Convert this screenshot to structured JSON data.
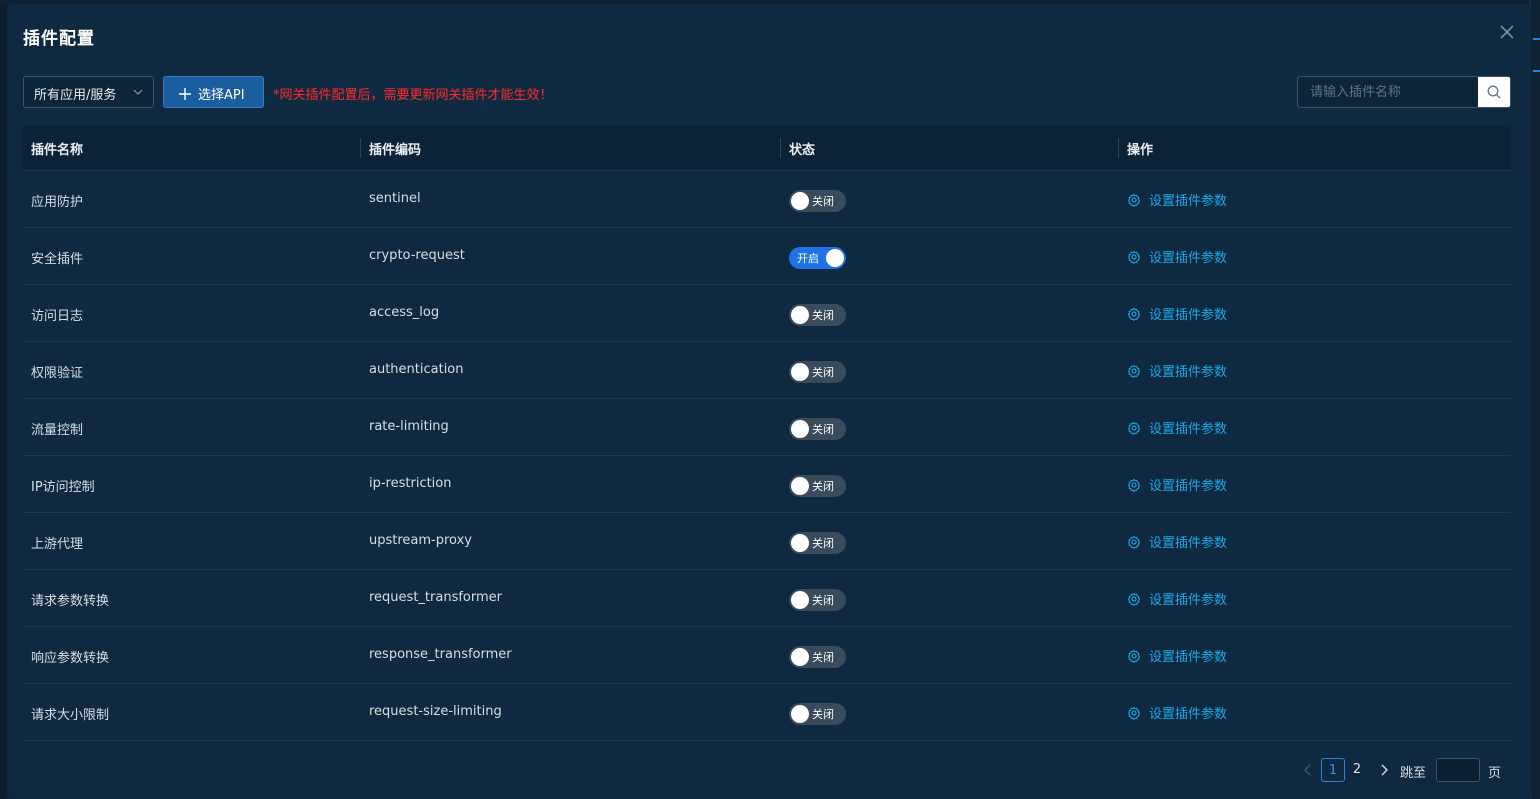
{
  "modal": {
    "title": "插件配置",
    "close_icon": "close-icon"
  },
  "toolbar": {
    "scope_select": "所有应用/服务",
    "select_api_label": "选择API",
    "warning": "*网关插件配置后，需要更新网关插件才能生效！",
    "search_placeholder": "请输入插件名称"
  },
  "table": {
    "headers": [
      "插件名称",
      "插件编码",
      "状态",
      "操作"
    ],
    "rows": [
      {
        "name": "应用防护",
        "code": "sentinel",
        "status": "关闭",
        "enabled": false,
        "action": "设置插件参数"
      },
      {
        "name": "安全插件",
        "code": "crypto-request",
        "status": "开启",
        "enabled": true,
        "action": "设置插件参数"
      },
      {
        "name": "访问日志",
        "code": "access_log",
        "status": "关闭",
        "enabled": false,
        "action": "设置插件参数"
      },
      {
        "name": "权限验证",
        "code": "authentication",
        "status": "关闭",
        "enabled": false,
        "action": "设置插件参数"
      },
      {
        "name": "流量控制",
        "code": "rate-limiting",
        "status": "关闭",
        "enabled": false,
        "action": "设置插件参数"
      },
      {
        "name": "IP访问控制",
        "code": "ip-restriction",
        "status": "关闭",
        "enabled": false,
        "action": "设置插件参数"
      },
      {
        "name": "上游代理",
        "code": "upstream-proxy",
        "status": "关闭",
        "enabled": false,
        "action": "设置插件参数"
      },
      {
        "name": "请求参数转换",
        "code": "request_transformer",
        "status": "关闭",
        "enabled": false,
        "action": "设置插件参数"
      },
      {
        "name": "响应参数转换",
        "code": "response_transformer",
        "status": "关闭",
        "enabled": false,
        "action": "设置插件参数"
      },
      {
        "name": "请求大小限制",
        "code": "request-size-limiting",
        "status": "关闭",
        "enabled": false,
        "action": "设置插件参数"
      }
    ]
  },
  "pagination": {
    "pages": [
      "1",
      "2"
    ],
    "current": "1",
    "jump_label": "跳至",
    "page_suffix": "页"
  },
  "colors": {
    "modal_bg": "#0f2a40",
    "accent": "#1f73e6",
    "link": "#1ea8e8",
    "warning": "#ff2a2a"
  }
}
